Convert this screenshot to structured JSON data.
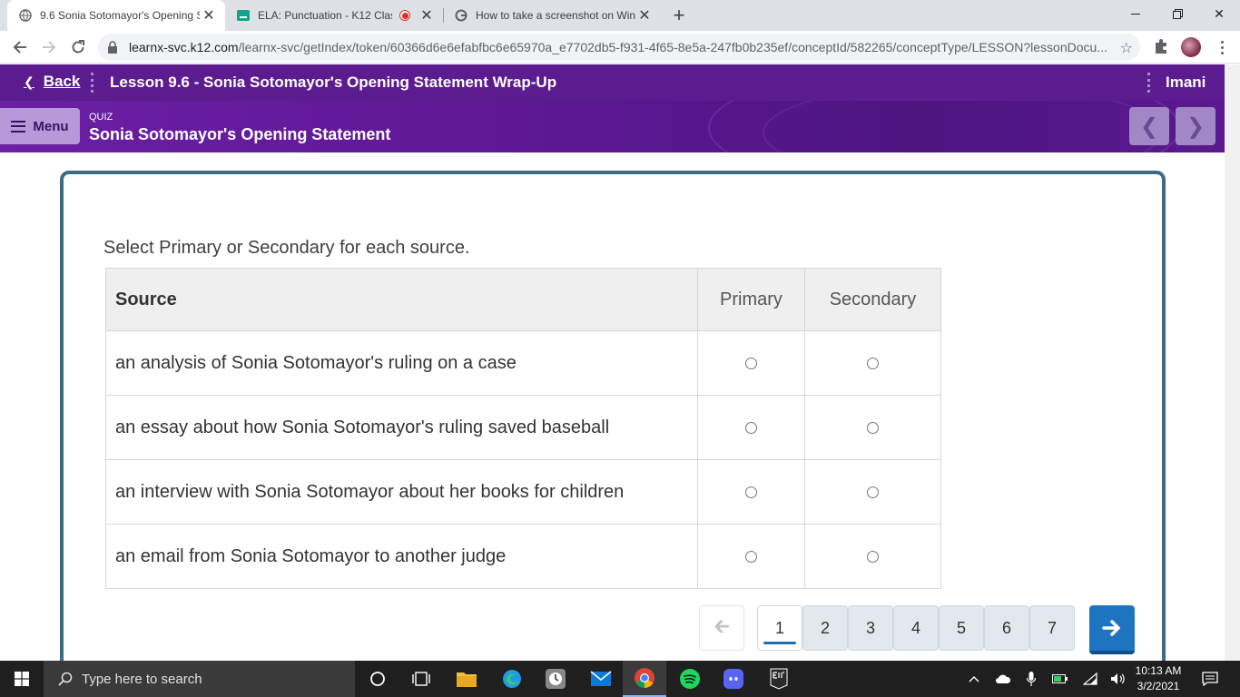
{
  "browser": {
    "tabs": [
      {
        "title": "9.6 Sonia Sotomayor's Opening S",
        "active": true,
        "favicon": "k12-globe-icon"
      },
      {
        "title": "ELA: Punctuation - K12 Class",
        "active": false,
        "favicon": "k12-class-icon",
        "recording": true
      },
      {
        "title": "How to take a screenshot on Win",
        "active": false,
        "favicon": "google-icon"
      }
    ],
    "url_host": "learnx-svc.k12.com",
    "url_path": "/learnx-svc/getIndex/token/60366d6e6efabfbc6e65970a_e7702db5-f931-4f65-8e5a-247fb0b235ef/conceptId/582265/conceptType/LESSON?lessonDocu..."
  },
  "header": {
    "back_label": "Back",
    "lesson_title": "Lesson 9.6 - Sonia Sotomayor's Opening Statement Wrap-Up",
    "user_name": "Imani",
    "menu_label": "Menu",
    "quiz_label": "QUIZ",
    "quiz_title": "Sonia Sotomayor's Opening Statement"
  },
  "question": {
    "prompt": "Select Primary or Secondary for each source.",
    "columns": {
      "source": "Source",
      "primary": "Primary",
      "secondary": "Secondary"
    },
    "rows": [
      {
        "source": "an analysis of Sonia Sotomayor's ruling on a case"
      },
      {
        "source": "an essay about how Sonia Sotomayor's ruling saved baseball"
      },
      {
        "source": "an interview with Sonia Sotomayor about her books for children"
      },
      {
        "source": "an email from Sonia Sotomayor to another judge"
      }
    ]
  },
  "pagination": {
    "pages": [
      "1",
      "2",
      "3",
      "4",
      "5",
      "6",
      "7"
    ],
    "current_page": "1"
  },
  "taskbar": {
    "search_placeholder": "Type here to search",
    "time": "10:13 AM",
    "date": "3/2/2021"
  },
  "colors": {
    "header_purple": "#5b1c8f",
    "card_border": "#3e6b84",
    "next_button": "#1d75c2"
  }
}
